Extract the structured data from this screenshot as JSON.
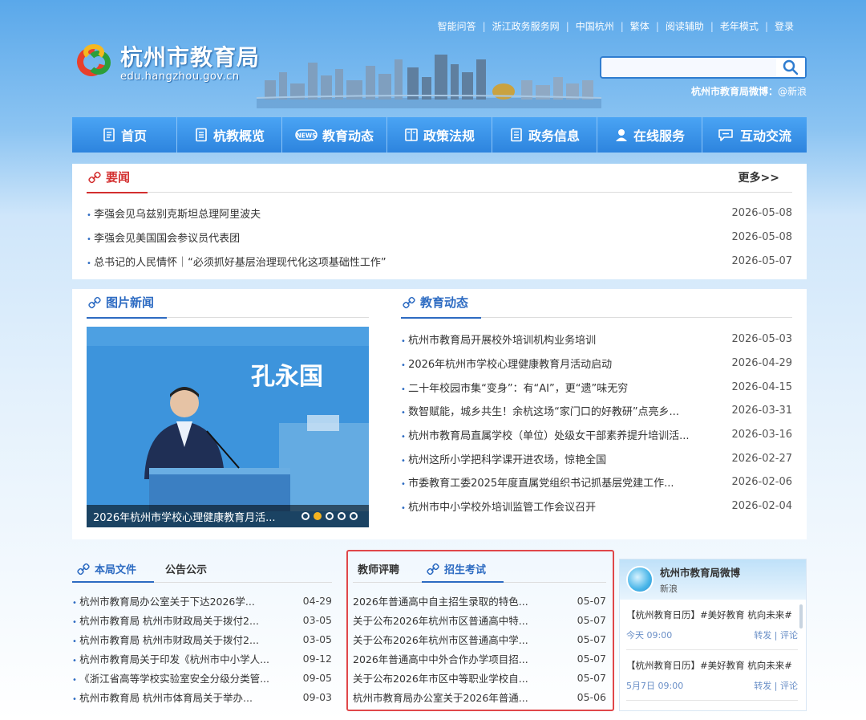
{
  "topbar": {
    "links": [
      "智能问答",
      "浙江政务服务网",
      "中国杭州",
      "繁体",
      "阅读辅助",
      "老年模式",
      "登录"
    ]
  },
  "logo": {
    "cn": "杭州市教育局",
    "en": "edu.hangzhou.gov.cn"
  },
  "search": {
    "placeholder": ""
  },
  "weibo_line": {
    "label": "杭州市教育局微博：",
    "value": "@新浪"
  },
  "nav": {
    "items": [
      {
        "label": "首页",
        "icon": "home-doc-icon"
      },
      {
        "label": "杭教概览",
        "icon": "overview-doc-icon"
      },
      {
        "label": "教育动态",
        "icon": "news-icon"
      },
      {
        "label": "政策法规",
        "icon": "policy-book-icon"
      },
      {
        "label": "政务信息",
        "icon": "info-doc-icon"
      },
      {
        "label": "在线服务",
        "icon": "person-icon"
      },
      {
        "label": "互动交流",
        "icon": "chat-icon"
      }
    ]
  },
  "yaowen": {
    "title": "要闻",
    "more": "更多>>",
    "items": [
      {
        "title": "李强会见乌兹别克斯坦总理阿里波夫",
        "date": "2026-05-08"
      },
      {
        "title": "李强会见美国国会参议员代表团",
        "date": "2026-05-08"
      },
      {
        "title": "总书记的人民情怀｜“必须抓好基层治理现代化这项基础性工作”",
        "date": "2026-05-07"
      }
    ]
  },
  "photo_news": {
    "title": "图片新闻",
    "caption": "2026年杭州市学校心理健康教育月活...",
    "banner_text": "孔永国",
    "slides": 5,
    "active_slide": 2
  },
  "edu_news": {
    "title": "教育动态",
    "items": [
      {
        "title": "杭州市教育局开展校外培训机构业务培训",
        "date": "2026-05-03"
      },
      {
        "title": "2026年杭州市学校心理健康教育月活动启动",
        "date": "2026-04-29"
      },
      {
        "title": "二十年校园市集“变身”：有“AI”，更“遗”味无穷",
        "date": "2026-04-15"
      },
      {
        "title": "数智赋能，城乡共生！余杭这场“家门口的好教研”点亮乡...",
        "date": "2026-03-31"
      },
      {
        "title": "杭州市教育局直属学校（单位）处级女干部素养提升培训活...",
        "date": "2026-03-16"
      },
      {
        "title": "杭州这所小学把科学课开进农场，惊艳全国",
        "date": "2026-02-27"
      },
      {
        "title": "市委教育工委2025年度直属党组织书记抓基层党建工作...",
        "date": "2026-02-06"
      },
      {
        "title": "杭州市中小学校外培训监管工作会议召开",
        "date": "2026-02-04"
      }
    ]
  },
  "docs": {
    "tabs": [
      "本局文件",
      "公告公示"
    ],
    "items": [
      {
        "title": "杭州市教育局办公室关于下达2026学...",
        "date": "04-29"
      },
      {
        "title": "杭州市教育局 杭州市财政局关于拨付2...",
        "date": "03-05"
      },
      {
        "title": "杭州市教育局 杭州市财政局关于拨付2...",
        "date": "03-05"
      },
      {
        "title": "杭州市教育局关于印发《杭州市中小学人...",
        "date": "09-12"
      },
      {
        "title": "《浙江省高等学校实验室安全分级分类管...",
        "date": "09-05"
      },
      {
        "title": "杭州市教育局 杭州市体育局关于举办...",
        "date": "09-03"
      }
    ]
  },
  "exams": {
    "tabs": [
      "教师评聘",
      "招生考试"
    ],
    "items": [
      {
        "title": "2026年普通高中自主招生录取的特色...",
        "date": "05-07"
      },
      {
        "title": "关于公布2026年杭州市区普通高中特...",
        "date": "05-07"
      },
      {
        "title": "关于公布2026年杭州市区普通高中学...",
        "date": "05-07"
      },
      {
        "title": "2026年普通高中中外合作办学项目招...",
        "date": "05-07"
      },
      {
        "title": "关于公布2026年市区中等职业学校自...",
        "date": "05-07"
      },
      {
        "title": "杭州市教育局办公室关于2026年普通...",
        "date": "05-06"
      }
    ]
  },
  "weibo": {
    "name": "杭州市教育局微博",
    "sub": "新浪",
    "posts": [
      {
        "text": "【杭州教育日历】#美好教育 杭向未来#",
        "time": "今天 09:00",
        "repost": "转发",
        "comment": "评论",
        "sep": "|"
      },
      {
        "text": "【杭州教育日历】#美好教育 杭向未来#",
        "time": "5月7日 09:00",
        "repost": "转发",
        "comment": "评论",
        "sep": "|"
      }
    ]
  },
  "colors": {
    "accent": "#2d6bc2",
    "nav": "#3a92e6",
    "red": "#d32f2f",
    "highlight": "#e0474a"
  }
}
